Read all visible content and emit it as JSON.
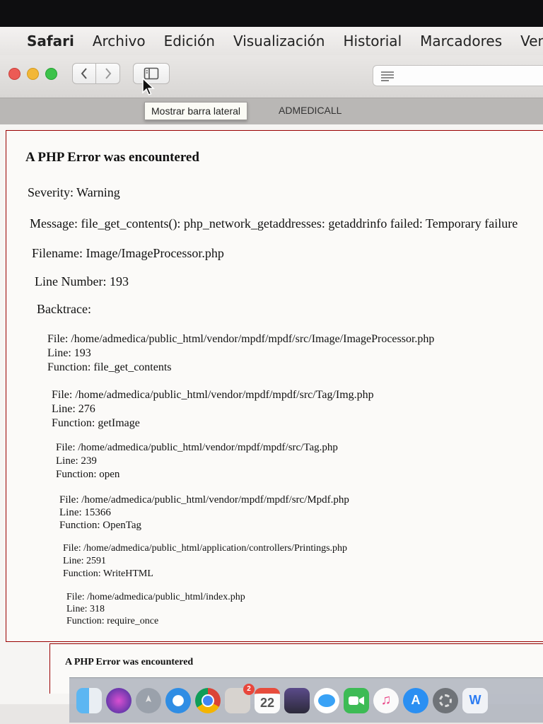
{
  "menubar": {
    "app_name": "Safari",
    "items": [
      "Archivo",
      "Edición",
      "Visualización",
      "Historial",
      "Marcadores",
      "Vent"
    ]
  },
  "toolbar": {
    "tooltip": "Mostrar barra lateral",
    "tab_title": "ADMEDICALL"
  },
  "error": {
    "heading": "A PHP Error was encountered",
    "severity": "Severity: Warning",
    "message": "Message: file_get_contents(): php_network_getaddresses: getaddrinfo failed: Temporary failure",
    "filename": "Filename: Image/ImageProcessor.php",
    "line_number": "Line Number: 193",
    "backtrace_label": "Backtrace:",
    "backtrace": [
      {
        "file": "File: /home/admedica/public_html/vendor/mpdf/mpdf/src/Image/ImageProcessor.php",
        "line": "Line: 193",
        "function": "Function: file_get_contents"
      },
      {
        "file": "File: /home/admedica/public_html/vendor/mpdf/mpdf/src/Tag/Img.php",
        "line": "Line: 276",
        "function": "Function: getImage"
      },
      {
        "file": "File: /home/admedica/public_html/vendor/mpdf/mpdf/src/Tag.php",
        "line": "Line: 239",
        "function": "Function: open"
      },
      {
        "file": "File: /home/admedica/public_html/vendor/mpdf/mpdf/src/Mpdf.php",
        "line": "Line: 15366",
        "function": "Function: OpenTag"
      },
      {
        "file": "File: /home/admedica/public_html/application/controllers/Printings.php",
        "line": "Line: 2591",
        "function": "Function: WriteHTML"
      },
      {
        "file": "File: /home/admedica/public_html/index.php",
        "line": "Line: 318",
        "function": "Function: require_once"
      }
    ]
  },
  "error2": {
    "heading": "A PHP Error was encountered"
  },
  "dock": {
    "calendar_day": "22",
    "badge": "2",
    "icons": [
      "finder-icon",
      "siri-icon",
      "launchpad-icon",
      "safari-icon",
      "chrome-icon",
      "photos-icon",
      "calendar-icon",
      "imovie-icon",
      "messages-icon",
      "facetime-icon",
      "music-icon",
      "appstore-icon",
      "preferences-icon",
      "pages-icon"
    ]
  },
  "colors": {
    "error_border": "#990000",
    "close": "#ec5b55",
    "minimize": "#f2b737",
    "zoom": "#3cc24a"
  }
}
